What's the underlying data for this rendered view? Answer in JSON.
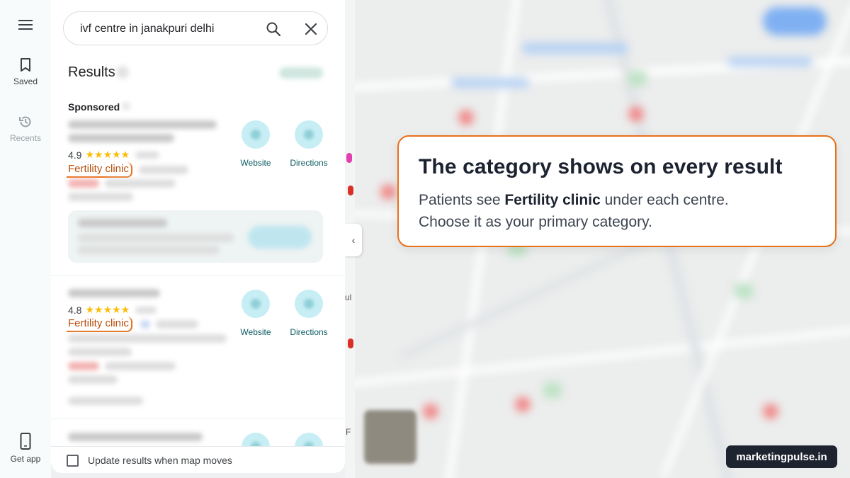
{
  "rail": {
    "saved_label": "Saved",
    "recents_label": "Recents",
    "get_app_label": "Get app"
  },
  "search": {
    "query": "ivf centre in janakpuri delhi"
  },
  "results": {
    "title": "Results",
    "sponsored_label": "Sponsored",
    "items": [
      {
        "rating": "4.9",
        "stars": "★★★★★",
        "category": "Fertility clinic",
        "website_label": "Website",
        "directions_label": "Directions"
      },
      {
        "rating": "4.8",
        "stars": "★★★★★",
        "category": "Fertility clinic",
        "website_label": "Website",
        "directions_label": "Directions"
      }
    ]
  },
  "bottom": {
    "update_label": "Update results when map moves"
  },
  "callout": {
    "title": "The category shows on every result",
    "line1_prefix": "Patients see ",
    "line1_bold": "Fertility clinic",
    "line1_suffix": " under each centre.",
    "line2": "Choose it as your primary category."
  },
  "map_labels": {
    "partial_1": "ul",
    "partial_2": "F"
  },
  "brand": {
    "name": "marketingpulse.in"
  },
  "colors": {
    "accent_orange": "#e8711a",
    "star_yellow": "#fbbc04",
    "action_teal": "#0d5c63"
  }
}
